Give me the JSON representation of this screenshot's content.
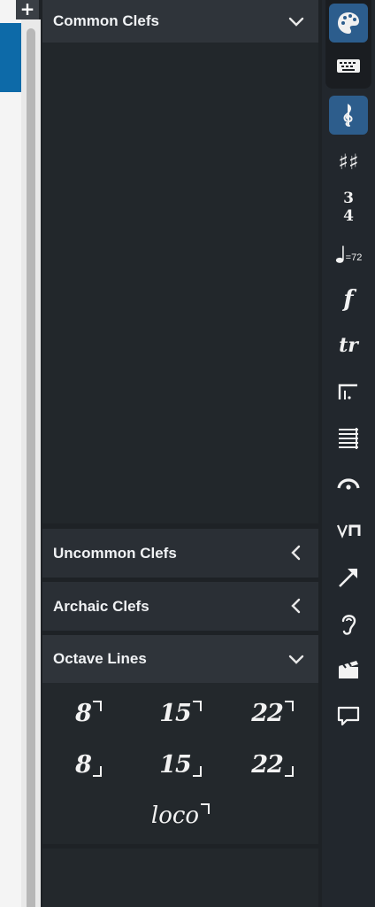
{
  "panel": {
    "sections": {
      "common": {
        "title": "Common Clefs"
      },
      "uncommon": {
        "title": "Uncommon Clefs"
      },
      "archaic": {
        "title": "Archaic Clefs"
      },
      "octave": {
        "title": "Octave Lines"
      }
    },
    "octave_items": [
      {
        "num": "8",
        "pos": "above"
      },
      {
        "num": "15",
        "pos": "above"
      },
      {
        "num": "22",
        "pos": "above"
      },
      {
        "num": "8",
        "pos": "below"
      },
      {
        "num": "15",
        "pos": "below"
      },
      {
        "num": "22",
        "pos": "below"
      }
    ],
    "loco": "loco"
  },
  "toolbar": {
    "items": [
      "palette-icon",
      "keyboard-icon",
      "treble-clef-icon",
      "key-signature-icon",
      "time-signature-icon",
      "tempo-icon",
      "dynamics-icon",
      "ornaments-icon",
      "repeat-brackets-icon",
      "layout-icon",
      "fermata-icon",
      "bowings-icon",
      "arrow-icon",
      "ear-icon",
      "clapper-icon",
      "comment-icon"
    ],
    "time_sig_top": "3",
    "time_sig_bottom": "4",
    "tempo_value": "=72",
    "dynamic": "f",
    "trill": "tr",
    "sharps": "♯♯",
    "add": "+"
  }
}
